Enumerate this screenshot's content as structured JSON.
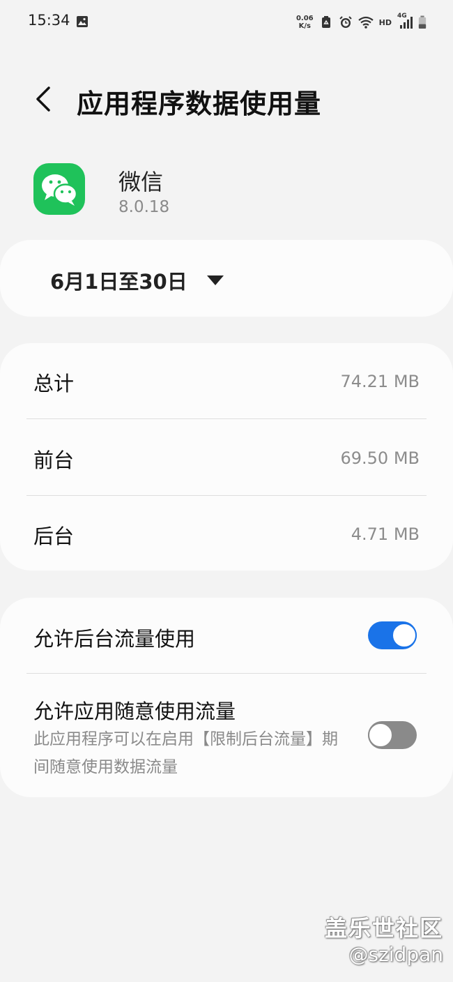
{
  "status_bar": {
    "time": "15:34",
    "net_speed_value": "0.06",
    "net_speed_unit": "K/s",
    "hd": "HD",
    "network": "4G"
  },
  "header": {
    "title": "应用程序数据使用量"
  },
  "app": {
    "name": "微信",
    "version": "8.0.18"
  },
  "date_range": {
    "label": "6月1日至30日"
  },
  "usage": {
    "rows": [
      {
        "label": "总计",
        "value": "74.21 MB"
      },
      {
        "label": "前台",
        "value": "69.50 MB"
      },
      {
        "label": "后台",
        "value": "4.71 MB"
      }
    ]
  },
  "settings": {
    "background_data": {
      "label": "允许后台流量使用",
      "enabled": true
    },
    "unrestricted_data": {
      "label": "允许应用随意使用流量",
      "description": "此应用程序可以在启用【限制后台流量】期间随意使用数据流量",
      "enabled": false
    }
  },
  "watermark": {
    "line1": "盖乐世社区",
    "line2": "@szidpan"
  },
  "colors": {
    "background": "#f3f3f3",
    "card": "#fcfcfc",
    "accent": "#1a73e8",
    "wechat_green": "#1fc25a",
    "secondary_text": "#8a8a8a"
  }
}
